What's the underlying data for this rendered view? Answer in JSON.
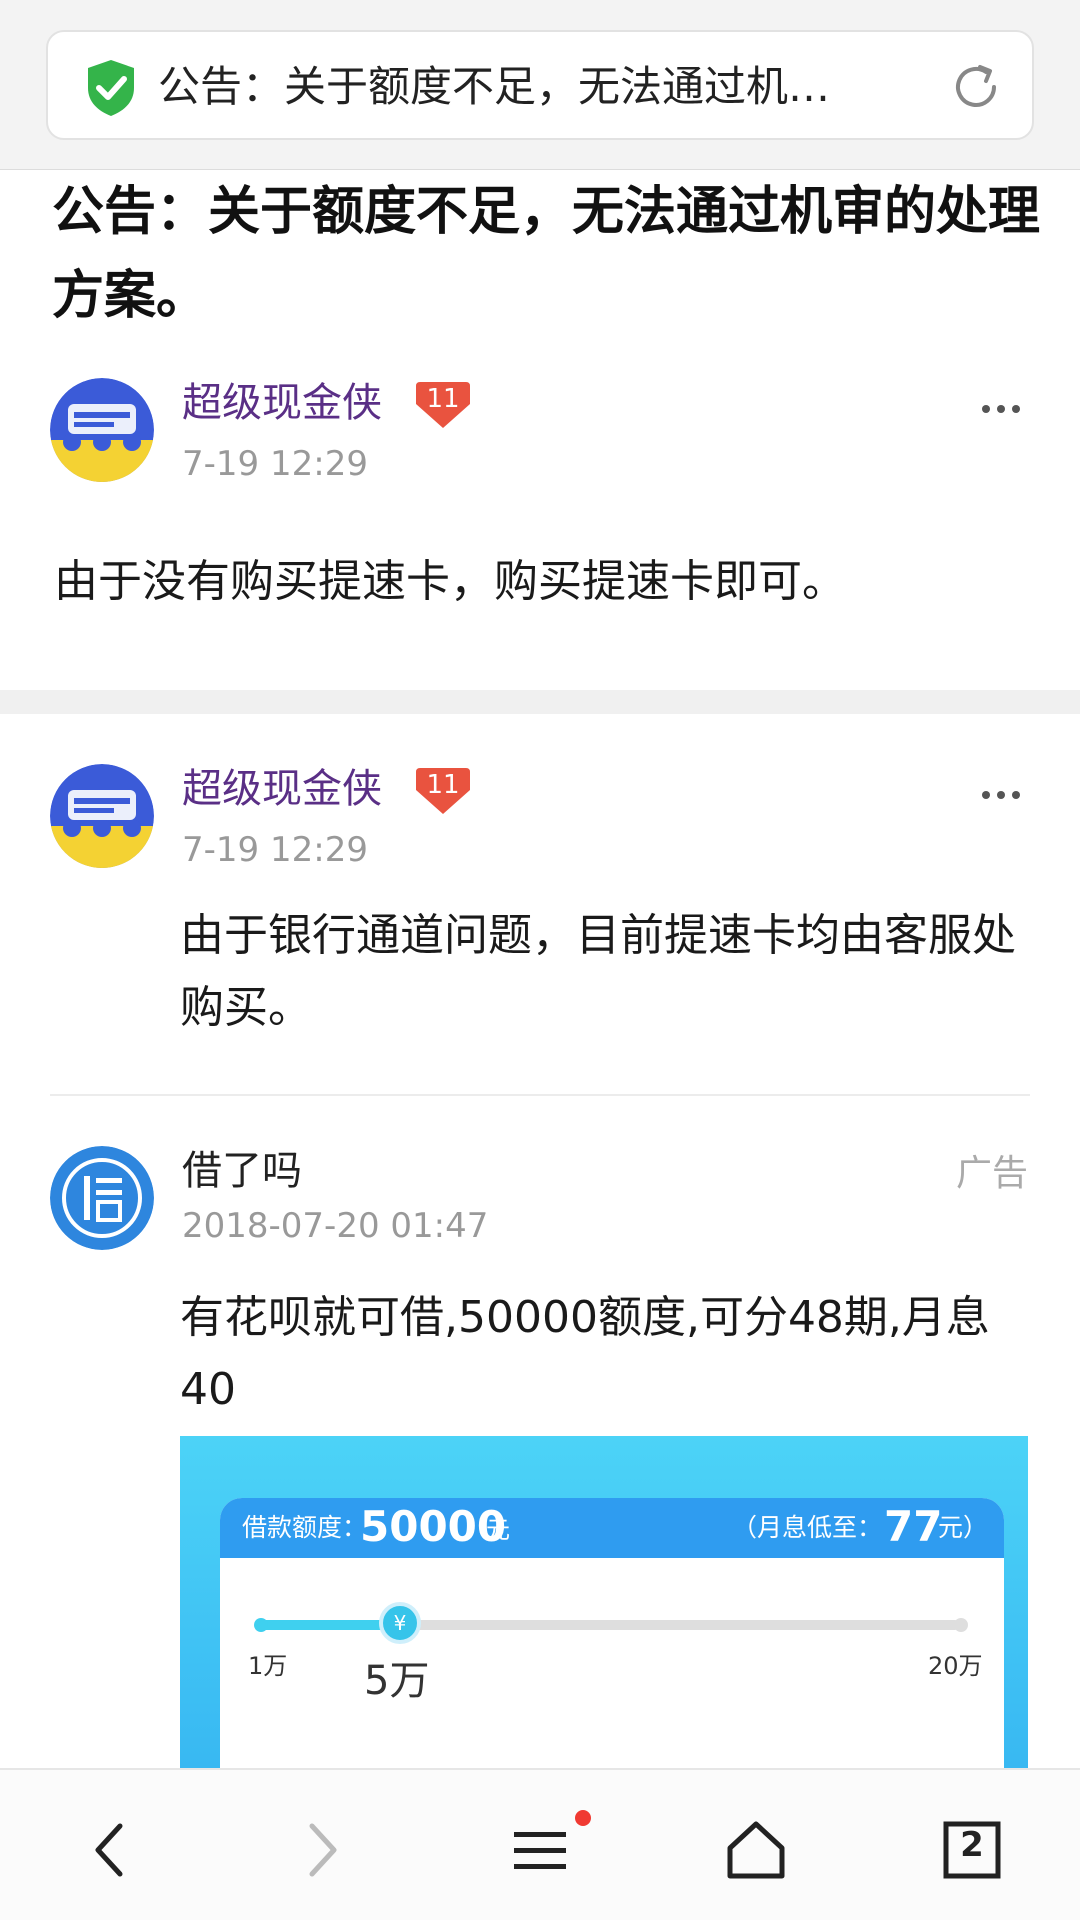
{
  "address_bar": {
    "title": "公告：关于额度不足，无法通过机…",
    "icons": [
      "shield-check-icon",
      "reload-icon"
    ],
    "shield_color": "#34b44a"
  },
  "article": {
    "title": "公告：关于额度不足，无法通过机审的处理方案。",
    "post": {
      "author": "超级现金侠",
      "level": "11",
      "time": "7-19 12:29",
      "content": "由于没有购买提速卡，购买提速卡即可。"
    }
  },
  "comments": [
    {
      "author": "超级现金侠",
      "level": "11",
      "time": "7-19 12:29",
      "content": "由于银行通道问题，目前提速卡均由客服处购买。"
    }
  ],
  "ad": {
    "advertiser": "借了吗",
    "time": "2018-07-20 01:47",
    "label": "广告",
    "content": "有花呗就可借,50000额度,可分48期,月息40",
    "image": {
      "amount_label": "借款额度：",
      "amount": "50000",
      "amount_unit": "元",
      "rate_label": "（月息低至：",
      "rate": "77",
      "rate_unit": "元）",
      "slider_min": "1万",
      "slider_value": "5万",
      "slider_max": "20万",
      "knob_symbol": "¥",
      "slider_fraction": 0.2
    }
  },
  "bottom_nav": {
    "items": [
      "back-icon",
      "forward-icon",
      "menu-icon",
      "home-icon",
      "tabs-icon"
    ],
    "tab_count": "2"
  },
  "colors": {
    "author": "#5a2f86",
    "level_badge": "#e9533f",
    "accent_blue": "#2f9cf0",
    "notification": "#f03a32"
  }
}
